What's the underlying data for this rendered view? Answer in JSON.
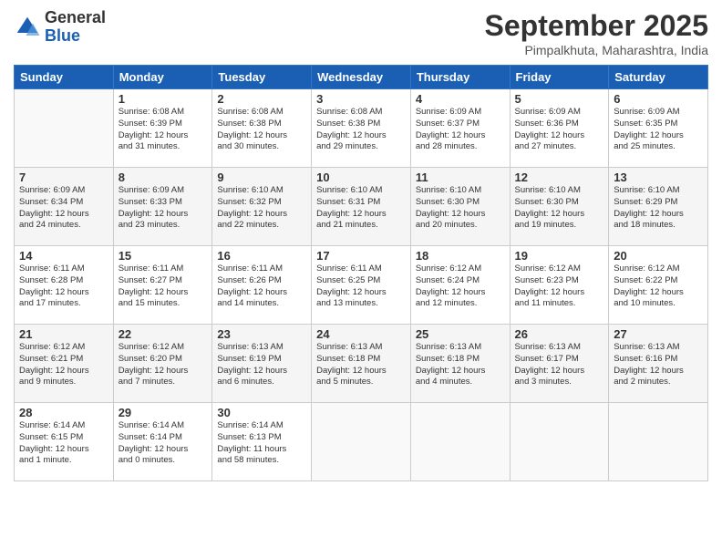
{
  "header": {
    "logo_general": "General",
    "logo_blue": "Blue",
    "month_title": "September 2025",
    "location": "Pimpalkhuta, Maharashtra, India"
  },
  "days_of_week": [
    "Sunday",
    "Monday",
    "Tuesday",
    "Wednesday",
    "Thursday",
    "Friday",
    "Saturday"
  ],
  "weeks": [
    [
      {
        "day": "",
        "info": ""
      },
      {
        "day": "1",
        "info": "Sunrise: 6:08 AM\nSunset: 6:39 PM\nDaylight: 12 hours\nand 31 minutes."
      },
      {
        "day": "2",
        "info": "Sunrise: 6:08 AM\nSunset: 6:38 PM\nDaylight: 12 hours\nand 30 minutes."
      },
      {
        "day": "3",
        "info": "Sunrise: 6:08 AM\nSunset: 6:38 PM\nDaylight: 12 hours\nand 29 minutes."
      },
      {
        "day": "4",
        "info": "Sunrise: 6:09 AM\nSunset: 6:37 PM\nDaylight: 12 hours\nand 28 minutes."
      },
      {
        "day": "5",
        "info": "Sunrise: 6:09 AM\nSunset: 6:36 PM\nDaylight: 12 hours\nand 27 minutes."
      },
      {
        "day": "6",
        "info": "Sunrise: 6:09 AM\nSunset: 6:35 PM\nDaylight: 12 hours\nand 25 minutes."
      }
    ],
    [
      {
        "day": "7",
        "info": "Sunrise: 6:09 AM\nSunset: 6:34 PM\nDaylight: 12 hours\nand 24 minutes."
      },
      {
        "day": "8",
        "info": "Sunrise: 6:09 AM\nSunset: 6:33 PM\nDaylight: 12 hours\nand 23 minutes."
      },
      {
        "day": "9",
        "info": "Sunrise: 6:10 AM\nSunset: 6:32 PM\nDaylight: 12 hours\nand 22 minutes."
      },
      {
        "day": "10",
        "info": "Sunrise: 6:10 AM\nSunset: 6:31 PM\nDaylight: 12 hours\nand 21 minutes."
      },
      {
        "day": "11",
        "info": "Sunrise: 6:10 AM\nSunset: 6:30 PM\nDaylight: 12 hours\nand 20 minutes."
      },
      {
        "day": "12",
        "info": "Sunrise: 6:10 AM\nSunset: 6:30 PM\nDaylight: 12 hours\nand 19 minutes."
      },
      {
        "day": "13",
        "info": "Sunrise: 6:10 AM\nSunset: 6:29 PM\nDaylight: 12 hours\nand 18 minutes."
      }
    ],
    [
      {
        "day": "14",
        "info": "Sunrise: 6:11 AM\nSunset: 6:28 PM\nDaylight: 12 hours\nand 17 minutes."
      },
      {
        "day": "15",
        "info": "Sunrise: 6:11 AM\nSunset: 6:27 PM\nDaylight: 12 hours\nand 15 minutes."
      },
      {
        "day": "16",
        "info": "Sunrise: 6:11 AM\nSunset: 6:26 PM\nDaylight: 12 hours\nand 14 minutes."
      },
      {
        "day": "17",
        "info": "Sunrise: 6:11 AM\nSunset: 6:25 PM\nDaylight: 12 hours\nand 13 minutes."
      },
      {
        "day": "18",
        "info": "Sunrise: 6:12 AM\nSunset: 6:24 PM\nDaylight: 12 hours\nand 12 minutes."
      },
      {
        "day": "19",
        "info": "Sunrise: 6:12 AM\nSunset: 6:23 PM\nDaylight: 12 hours\nand 11 minutes."
      },
      {
        "day": "20",
        "info": "Sunrise: 6:12 AM\nSunset: 6:22 PM\nDaylight: 12 hours\nand 10 minutes."
      }
    ],
    [
      {
        "day": "21",
        "info": "Sunrise: 6:12 AM\nSunset: 6:21 PM\nDaylight: 12 hours\nand 9 minutes."
      },
      {
        "day": "22",
        "info": "Sunrise: 6:12 AM\nSunset: 6:20 PM\nDaylight: 12 hours\nand 7 minutes."
      },
      {
        "day": "23",
        "info": "Sunrise: 6:13 AM\nSunset: 6:19 PM\nDaylight: 12 hours\nand 6 minutes."
      },
      {
        "day": "24",
        "info": "Sunrise: 6:13 AM\nSunset: 6:18 PM\nDaylight: 12 hours\nand 5 minutes."
      },
      {
        "day": "25",
        "info": "Sunrise: 6:13 AM\nSunset: 6:18 PM\nDaylight: 12 hours\nand 4 minutes."
      },
      {
        "day": "26",
        "info": "Sunrise: 6:13 AM\nSunset: 6:17 PM\nDaylight: 12 hours\nand 3 minutes."
      },
      {
        "day": "27",
        "info": "Sunrise: 6:13 AM\nSunset: 6:16 PM\nDaylight: 12 hours\nand 2 minutes."
      }
    ],
    [
      {
        "day": "28",
        "info": "Sunrise: 6:14 AM\nSunset: 6:15 PM\nDaylight: 12 hours\nand 1 minute."
      },
      {
        "day": "29",
        "info": "Sunrise: 6:14 AM\nSunset: 6:14 PM\nDaylight: 12 hours\nand 0 minutes."
      },
      {
        "day": "30",
        "info": "Sunrise: 6:14 AM\nSunset: 6:13 PM\nDaylight: 11 hours\nand 58 minutes."
      },
      {
        "day": "",
        "info": ""
      },
      {
        "day": "",
        "info": ""
      },
      {
        "day": "",
        "info": ""
      },
      {
        "day": "",
        "info": ""
      }
    ]
  ]
}
